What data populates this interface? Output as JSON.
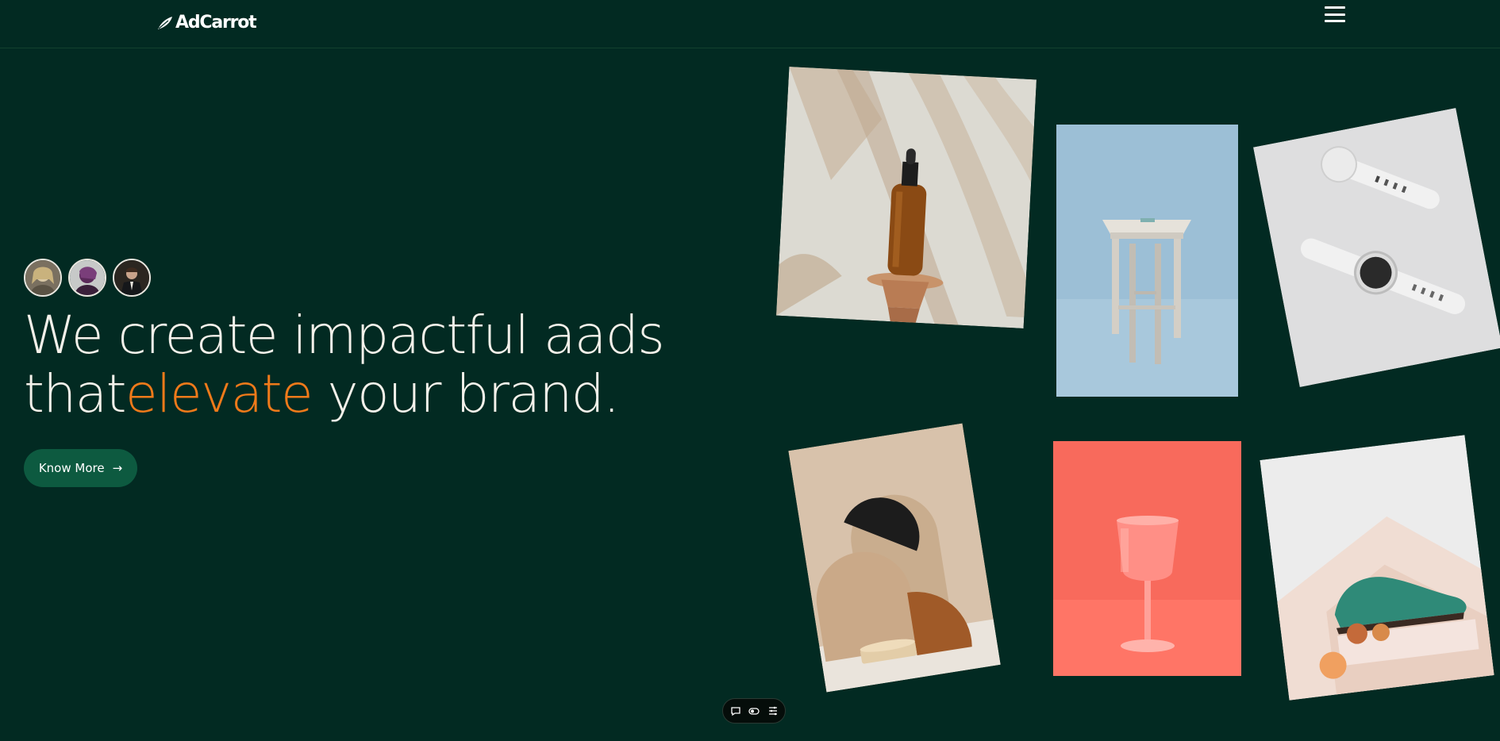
{
  "header": {
    "logo_text": "AdCarrot",
    "logo_icon": "carrot-leaf-icon",
    "menu_icon": "hamburger-menu-icon"
  },
  "hero": {
    "avatars": [
      {
        "name": "avatar-1",
        "icon": "person-avatar"
      },
      {
        "name": "avatar-2",
        "icon": "person-avatar"
      },
      {
        "name": "avatar-3",
        "icon": "person-avatar"
      }
    ],
    "headline_line1": "We create impactful aads",
    "headline_line2_start": "that",
    "headline_accent": "elevate",
    "headline_line2_end": " your brand.",
    "cta_label": "Know More",
    "cta_icon": "arrow-right-icon"
  },
  "gallery": {
    "items": [
      {
        "name": "dropper-bottle-photo"
      },
      {
        "name": "wooden-stool-photo"
      },
      {
        "name": "smartwatch-photo"
      },
      {
        "name": "abstract-shapes-photo"
      },
      {
        "name": "pink-wine-glass-photo"
      },
      {
        "name": "green-shoe-photo"
      }
    ]
  },
  "dock": {
    "items": [
      "chat-bubble-icon",
      "toggle-icon",
      "settings-list-icon"
    ]
  },
  "colors": {
    "background": "#022a22",
    "accent": "#f07a1a",
    "cta_bg": "#0d5a40",
    "text": "#f4f1ea"
  }
}
